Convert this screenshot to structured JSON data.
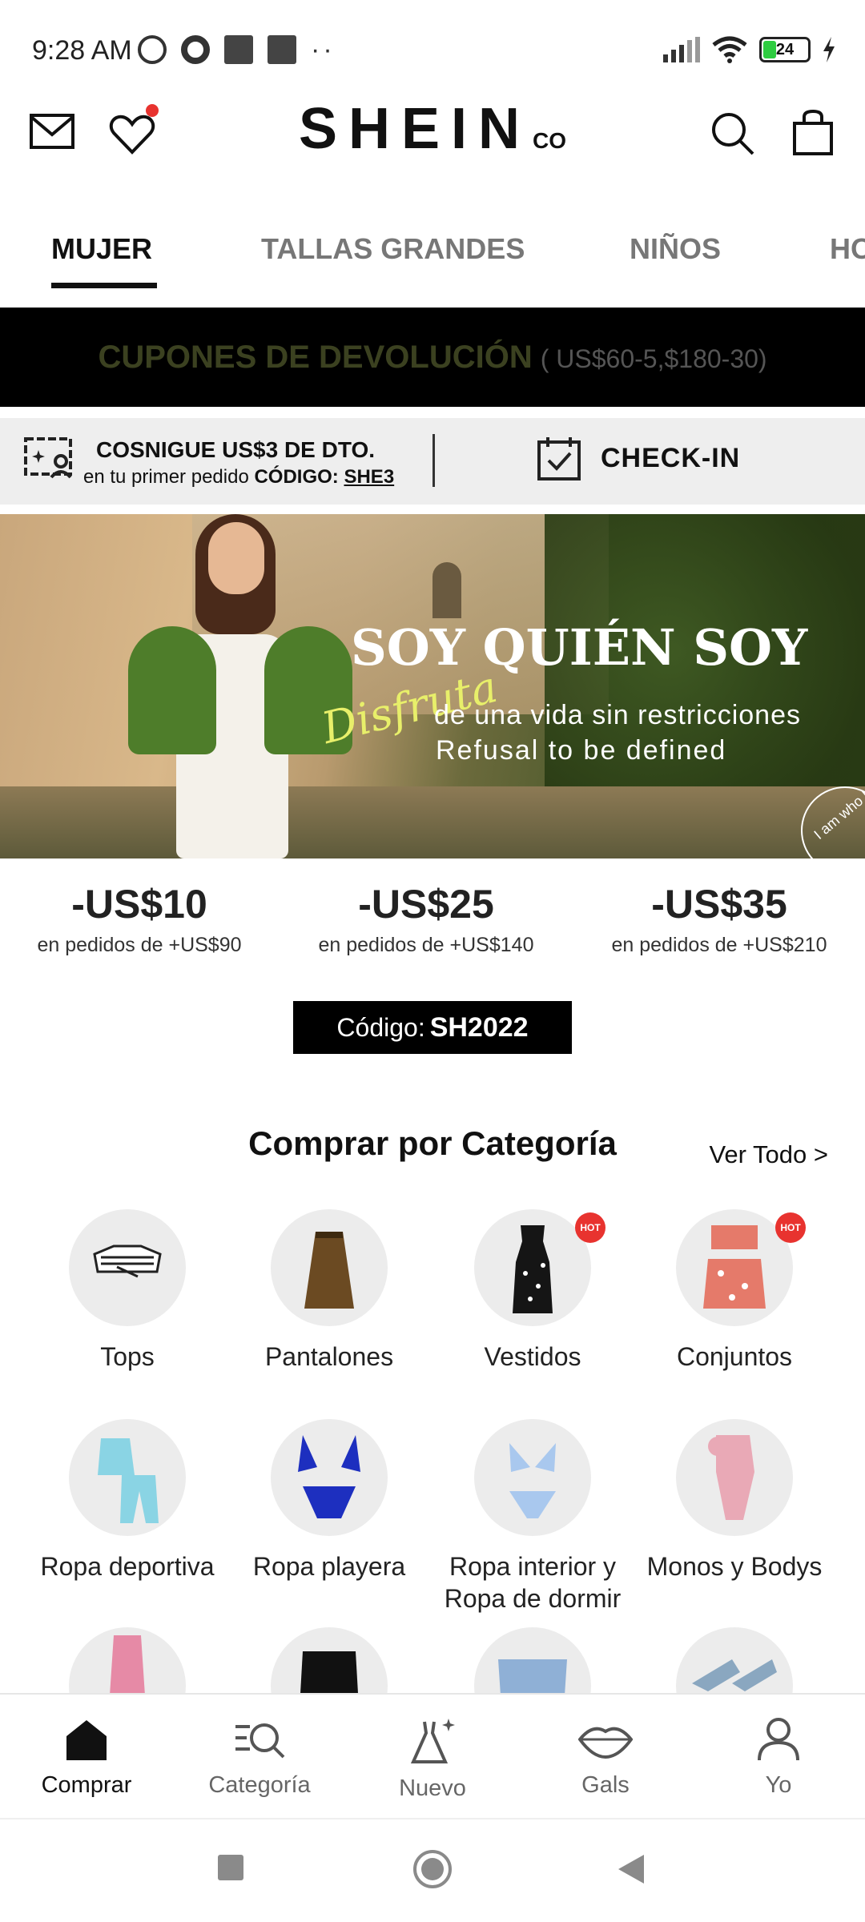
{
  "status_bar": {
    "time": "9:28 AM",
    "battery": "24",
    "icons": [
      "alarm-icon",
      "app-icon",
      "square-icon",
      "square-icon",
      "dots-icon",
      "signal-icon",
      "wifi-icon",
      "battery-icon",
      "charging-icon"
    ]
  },
  "header": {
    "logo": "SHEIN",
    "logo_suffix": "CO",
    "icons": [
      "mail-icon",
      "heart-icon",
      "search-icon",
      "bag-icon"
    ]
  },
  "tabs": [
    {
      "label": "MUJER",
      "active": true
    },
    {
      "label": "TALLAS GRANDES",
      "active": false
    },
    {
      "label": "NIÑOS",
      "active": false
    },
    {
      "label": "HO",
      "active": false
    }
  ],
  "coupon_banner": {
    "main": "CUPONES DE DEVOLUCIÓN",
    "sub": "( US$60-5,$180-30)"
  },
  "promo_bar": {
    "title": "COSNIGUE US$3 DE DTO.",
    "subtitle_prefix": "en tu primer pedido",
    "code_label": "CÓDIGO:",
    "code": "SHE3",
    "checkin": "CHECK-IN"
  },
  "hero": {
    "title": "SOY QUIÉN SOY",
    "script": "Disfruta",
    "line1": "de una vida sin restricciones",
    "line2": "Refusal to be defined",
    "circle_text": "I am who I am"
  },
  "offers": [
    {
      "amount": "-US$10",
      "condition": "en pedidos de +US$90"
    },
    {
      "amount": "-US$25",
      "condition": "en pedidos de +US$140"
    },
    {
      "amount": "-US$35",
      "condition": "en pedidos de +US$210"
    }
  ],
  "code_box": {
    "label": "Código:",
    "code": "SH2022"
  },
  "categories": {
    "title": "Comprar por Categoría",
    "see_all": "Ver Todo >",
    "hot_label": "HOT",
    "items": [
      {
        "label": "Tops",
        "hot": false
      },
      {
        "label": "Pantalones",
        "hot": false
      },
      {
        "label": "Vestidos",
        "hot": true
      },
      {
        "label": "Conjuntos",
        "hot": true
      },
      {
        "label": "Ropa deportiva",
        "hot": false
      },
      {
        "label": "Ropa playera",
        "hot": false
      },
      {
        "label": "Ropa interior y",
        "label2": "Ropa de dormir",
        "hot": false
      },
      {
        "label": "Monos y Bodys",
        "hot": false
      }
    ]
  },
  "bottom_nav": [
    {
      "label": "Comprar",
      "icon": "home-icon",
      "active": true
    },
    {
      "label": "Categoría",
      "icon": "category-search-icon",
      "active": false
    },
    {
      "label": "Nuevo",
      "icon": "dress-sparkle-icon",
      "active": false
    },
    {
      "label": "Gals",
      "icon": "lips-icon",
      "active": false
    },
    {
      "label": "Yo",
      "icon": "person-icon",
      "active": false
    }
  ],
  "colors": {
    "accent": "#e8332f",
    "banner_bg": "#000000",
    "banner_text": "#3b4120",
    "promo_bg": "#eeeeee"
  }
}
